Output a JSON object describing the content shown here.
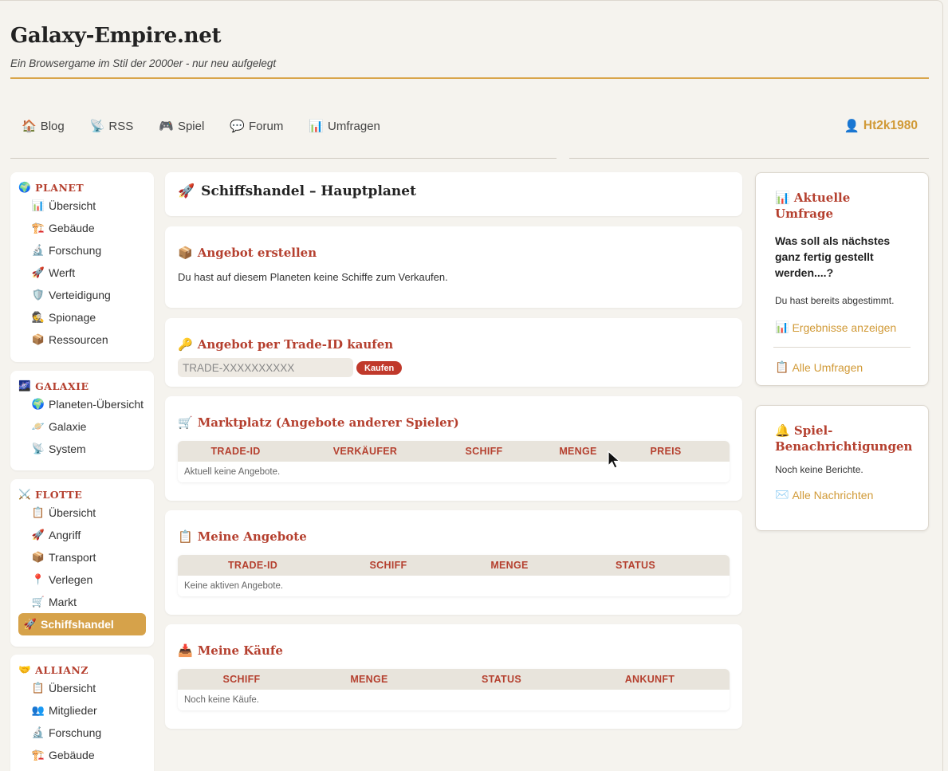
{
  "site": {
    "title": "Galaxy-Empire.net",
    "subtitle": "Ein Browsergame im Stil der 2000er - nur neu aufgelegt"
  },
  "topnav": {
    "items": [
      {
        "icon": "🏠",
        "label": "Blog"
      },
      {
        "icon": "📡",
        "label": "RSS"
      },
      {
        "icon": "🎮",
        "label": "Spiel"
      },
      {
        "icon": "💬",
        "label": "Forum"
      },
      {
        "icon": "📊",
        "label": "Umfragen"
      }
    ],
    "user": {
      "icon": "👤",
      "label": "Ht2k1980"
    }
  },
  "sidebar": {
    "planet": {
      "icon": "🌍",
      "heading": "PLANET",
      "items": [
        {
          "icon": "📊",
          "label": "Übersicht"
        },
        {
          "icon": "🏗️",
          "label": "Gebäude"
        },
        {
          "icon": "🔬",
          "label": "Forschung"
        },
        {
          "icon": "🚀",
          "label": "Werft"
        },
        {
          "icon": "🛡️",
          "label": "Verteidigung"
        },
        {
          "icon": "🕵️",
          "label": "Spionage"
        },
        {
          "icon": "📦",
          "label": "Ressourcen"
        }
      ]
    },
    "galaxie": {
      "icon": "🌌",
      "heading": "GALAXIE",
      "items": [
        {
          "icon": "🌍",
          "label": "Planeten-Übersicht"
        },
        {
          "icon": "🪐",
          "label": "Galaxie"
        },
        {
          "icon": "📡",
          "label": "System"
        }
      ]
    },
    "flotte": {
      "icon": "⚔️",
      "heading": "FLOTTE",
      "items": [
        {
          "icon": "📋",
          "label": "Übersicht"
        },
        {
          "icon": "🚀",
          "label": "Angriff"
        },
        {
          "icon": "📦",
          "label": "Transport"
        },
        {
          "icon": "📍",
          "label": "Verlegen"
        },
        {
          "icon": "🛒",
          "label": "Markt"
        },
        {
          "icon": "🚀",
          "label": "Schiffshandel"
        }
      ]
    },
    "allianz": {
      "icon": "🤝",
      "heading": "ALLIANZ",
      "items": [
        {
          "icon": "📋",
          "label": "Übersicht"
        },
        {
          "icon": "👥",
          "label": "Mitglieder"
        },
        {
          "icon": "🔬",
          "label": "Forschung"
        },
        {
          "icon": "🏗️",
          "label": "Gebäude"
        }
      ]
    }
  },
  "main": {
    "page_title": {
      "icon": "🚀",
      "text": "Schiffshandel – Hauptplanet"
    },
    "create_offer": {
      "icon": "📦",
      "title": "Angebot erstellen",
      "text": "Du hast auf diesem Planeten keine Schiffe zum Verkaufen."
    },
    "buy_by_id": {
      "icon": "🔑",
      "title": "Angebot per Trade-ID kaufen",
      "placeholder": "TRADE-XXXXXXXXXX",
      "button": "Kaufen"
    },
    "marketplace": {
      "icon": "🛒",
      "title": "Marktplatz (Angebote anderer Spieler)",
      "columns": [
        "TRADE-ID",
        "VERKÄUFER",
        "SCHIFF",
        "MENGE",
        "PREIS"
      ],
      "empty": "Aktuell keine Angebote."
    },
    "my_offers": {
      "icon": "📋",
      "title": "Meine Angebote",
      "columns": [
        "TRADE-ID",
        "SCHIFF",
        "MENGE",
        "STATUS"
      ],
      "empty": "Keine aktiven Angebote."
    },
    "my_purchases": {
      "icon": "📥",
      "title": "Meine Käufe",
      "columns": [
        "SCHIFF",
        "MENGE",
        "STATUS",
        "ANKUNFT"
      ],
      "empty": "Noch keine Käufe."
    }
  },
  "right": {
    "poll": {
      "icon": "📊",
      "title": "Aktuelle Umfrage",
      "question": "Was soll als nächstes ganz fertig gestellt werden....?",
      "note": "Du hast bereits abgestimmt.",
      "results_icon": "📊",
      "results_link": "Ergebnisse anzeigen",
      "all_icon": "📋",
      "all_link": "Alle Umfragen"
    },
    "notifications": {
      "icon": "🔔",
      "title": "Spiel-Benachrichtigungen",
      "text": "Noch keine Berichte.",
      "link_icon": "✉️",
      "link": "Alle Nachrichten"
    }
  },
  "colors": {
    "accent_gold": "#d6a24a",
    "heading_red": "#b5402f",
    "button_red": "#c0392b",
    "background": "#f5f3ee"
  }
}
